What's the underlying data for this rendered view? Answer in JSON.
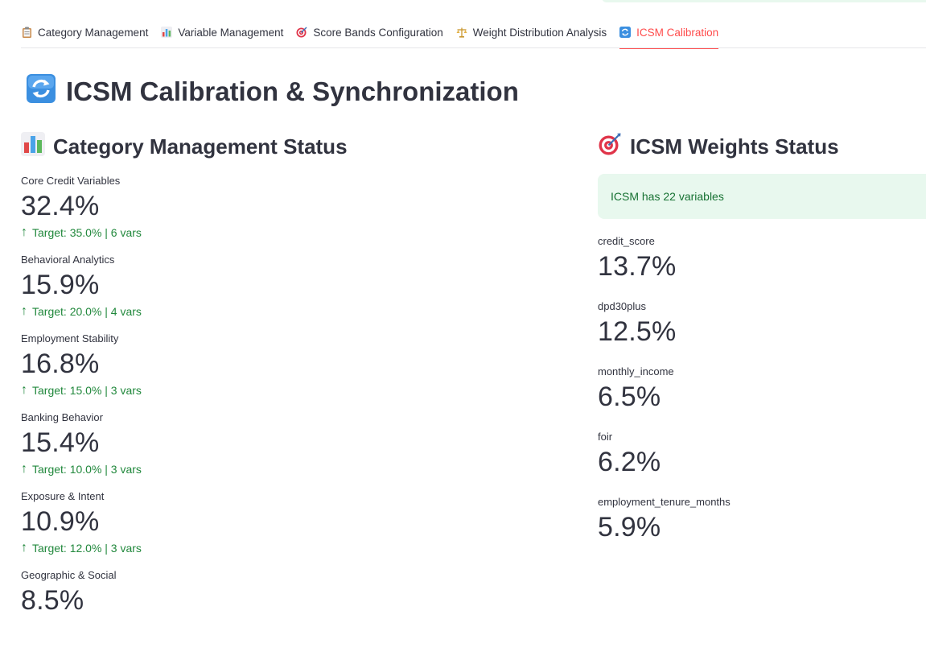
{
  "tabs": [
    {
      "label": "Category Management",
      "icon": "clipboard-icon"
    },
    {
      "label": "Variable Management",
      "icon": "bar-chart-icon"
    },
    {
      "label": "Score Bands Configuration",
      "icon": "target-icon"
    },
    {
      "label": "Weight Distribution Analysis",
      "icon": "scales-icon"
    },
    {
      "label": "ICSM Calibration",
      "icon": "refresh-icon",
      "active": true
    }
  ],
  "page": {
    "title": "ICSM Calibration & Synchronization"
  },
  "category_status": {
    "title": "Category Management Status",
    "metrics": [
      {
        "label": "Core Credit Variables",
        "value": "32.4%",
        "delta": "Target: 35.0% | 6 vars"
      },
      {
        "label": "Behavioral Analytics",
        "value": "15.9%",
        "delta": "Target: 20.0% | 4 vars"
      },
      {
        "label": "Employment Stability",
        "value": "16.8%",
        "delta": "Target: 15.0% | 3 vars"
      },
      {
        "label": "Banking Behavior",
        "value": "15.4%",
        "delta": "Target: 10.0% | 3 vars"
      },
      {
        "label": "Exposure & Intent",
        "value": "10.9%",
        "delta": "Target: 12.0% | 3 vars"
      },
      {
        "label": "Geographic & Social",
        "value": "8.5%",
        "delta": ""
      }
    ]
  },
  "weights_status": {
    "title": "ICSM Weights Status",
    "info": "ICSM has 22 variables",
    "metrics": [
      {
        "label": "credit_score",
        "value": "13.7%"
      },
      {
        "label": "dpd30plus",
        "value": "12.5%"
      },
      {
        "label": "monthly_income",
        "value": "6.5%"
      },
      {
        "label": "foir",
        "value": "6.2%"
      },
      {
        "label": "employment_tenure_months",
        "value": "5.9%"
      }
    ]
  },
  "colors": {
    "accent": "#ff4b4b",
    "delta_green": "#21883c",
    "success_bg": "#e8f8ee",
    "success_text": "#177233"
  }
}
